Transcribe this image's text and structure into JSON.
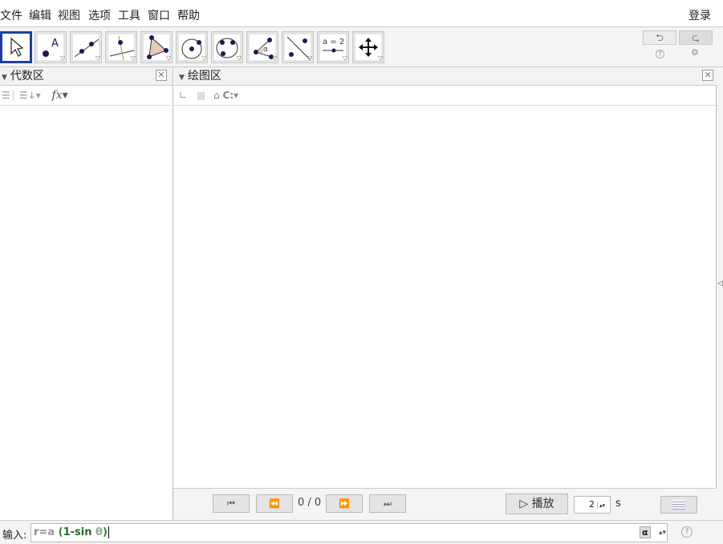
{
  "menu": {
    "items": [
      "文件",
      "编辑",
      "视图",
      "选项",
      "工具",
      "窗口",
      "帮助"
    ],
    "login": "登录"
  },
  "toolbar": {
    "tools": [
      {
        "name": "move-tool",
        "icon": "arrow"
      },
      {
        "name": "point-tool",
        "icon": "point-A",
        "label": "A"
      },
      {
        "name": "line-tool",
        "icon": "line"
      },
      {
        "name": "perpendicular-tool",
        "icon": "perpendicular"
      },
      {
        "name": "polygon-tool",
        "icon": "polygon"
      },
      {
        "name": "circle-tool",
        "icon": "circle-center"
      },
      {
        "name": "circle-3pts-tool",
        "icon": "circle-3pts"
      },
      {
        "name": "angle-tool",
        "icon": "angle",
        "label": "α"
      },
      {
        "name": "reflect-tool",
        "icon": "reflect"
      },
      {
        "name": "slider-tool",
        "icon": "slider",
        "label": "a = 2"
      },
      {
        "name": "move-view-tool",
        "icon": "move-graphics"
      }
    ],
    "undo": "⮌",
    "redo": "⮎",
    "help": "?",
    "settings": "⚙"
  },
  "algebra": {
    "title": "代数区"
  },
  "graphics": {
    "title": "绘图区"
  },
  "animation": {
    "counter": "0 / 0",
    "play": "▷ 播放",
    "speed": "2",
    "unit": "s"
  },
  "input": {
    "label": "输入:",
    "value_parts": [
      {
        "t": "r=",
        "c": "#888"
      },
      {
        "t": "a ",
        "c": "#999"
      },
      {
        "t": "(",
        "c": "#2a8a2a"
      },
      {
        "t": "1-sin ",
        "c": "#2a6a2a"
      },
      {
        "t": "θ",
        "c": "#9a9"
      },
      {
        "t": ")",
        "c": "#2a8a2a"
      }
    ],
    "alpha": "α",
    "help": "?"
  }
}
